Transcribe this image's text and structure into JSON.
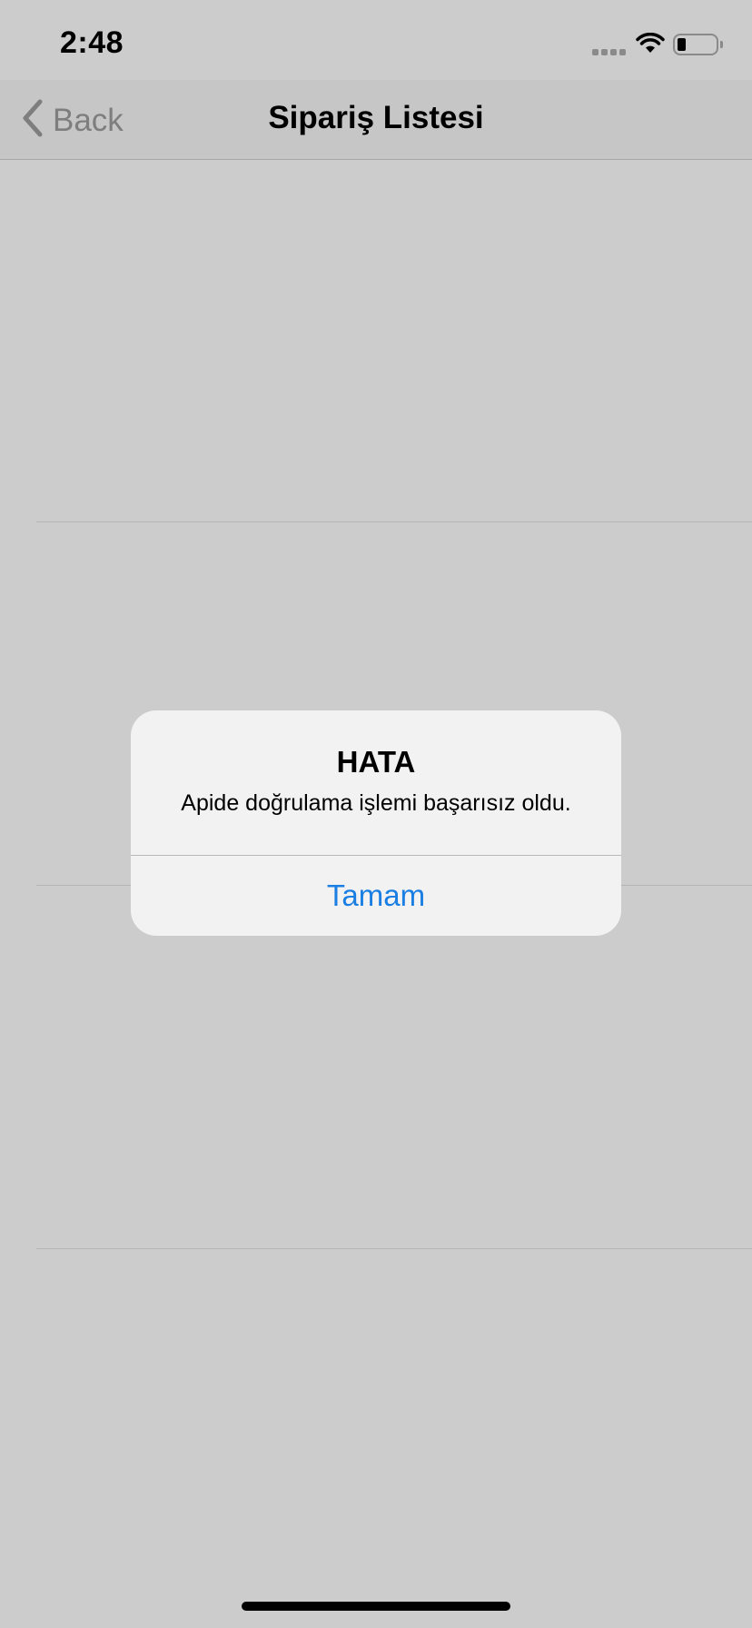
{
  "status_bar": {
    "time": "2:48",
    "icons": [
      "signal-icon",
      "wifi-icon",
      "battery-icon"
    ]
  },
  "nav_bar": {
    "back_label": "Back",
    "title": "Sipariş Listesi"
  },
  "alert": {
    "title": "HATA",
    "message": "Apide doğrulama işlemi başarısız oldu.",
    "button_label": "Tamam"
  },
  "colors": {
    "background": "#cccccc",
    "accent": "#1a7ee3",
    "alert_background": "#f2f2f2"
  }
}
